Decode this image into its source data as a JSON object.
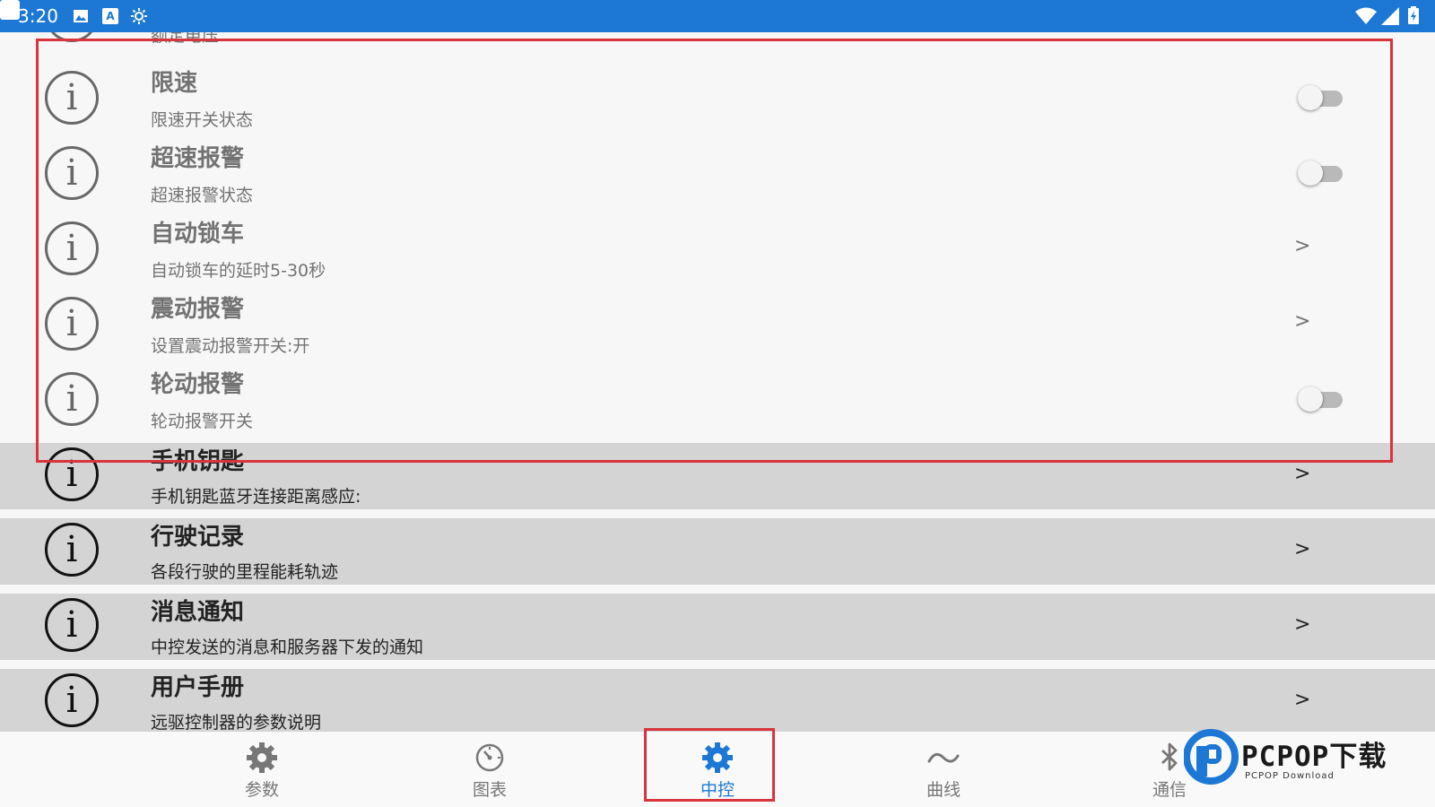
{
  "status_bar": {
    "time": "3:20"
  },
  "list": {
    "items": [
      {
        "title": "",
        "subtitle": "额定电压",
        "control": "none"
      },
      {
        "title": "限速",
        "subtitle": "限速开关状态",
        "control": "toggle",
        "on": false
      },
      {
        "title": "超速报警",
        "subtitle": "超速报警状态",
        "control": "toggle",
        "on": false
      },
      {
        "title": "自动锁车",
        "subtitle": "自动锁车的延时5-30秒",
        "control": "chevron",
        "chevron": ">"
      },
      {
        "title": "震动报警",
        "subtitle": "设置震动报警开关:开",
        "control": "chevron",
        "chevron": ">"
      },
      {
        "title": "轮动报警",
        "subtitle": "轮动报警开关",
        "control": "toggle",
        "on": false
      },
      {
        "title": "手机钥匙",
        "subtitle": "手机钥匙蓝牙连接距离感应:",
        "control": "chevron",
        "chevron": ">"
      },
      {
        "title": "行驶记录",
        "subtitle": "各段行驶的里程能耗轨迹",
        "control": "chevron",
        "chevron": ">"
      },
      {
        "title": "消息通知",
        "subtitle": "中控发送的消息和服务器下发的通知",
        "control": "chevron",
        "chevron": ">"
      },
      {
        "title": "用户手册",
        "subtitle": "远驱控制器的参数说明",
        "control": "chevron",
        "chevron": ">"
      }
    ],
    "info_glyph": "i"
  },
  "bottom_nav": {
    "items": [
      {
        "label": "参数",
        "icon": "gear-icon"
      },
      {
        "label": "图表",
        "icon": "gauge-icon"
      },
      {
        "label": "中控",
        "icon": "gear-icon",
        "active": true
      },
      {
        "label": "曲线",
        "icon": "wave-icon"
      },
      {
        "label": "通信",
        "icon": "bluetooth-icon"
      }
    ]
  },
  "watermark": {
    "brand": "PCPOP下载",
    "sub": "PCPOP Download"
  },
  "colors": {
    "status_bar": "#1c78d4",
    "accent": "#1c78d4",
    "highlight": "#d9343c",
    "row_gray": "#d4d4d4"
  }
}
